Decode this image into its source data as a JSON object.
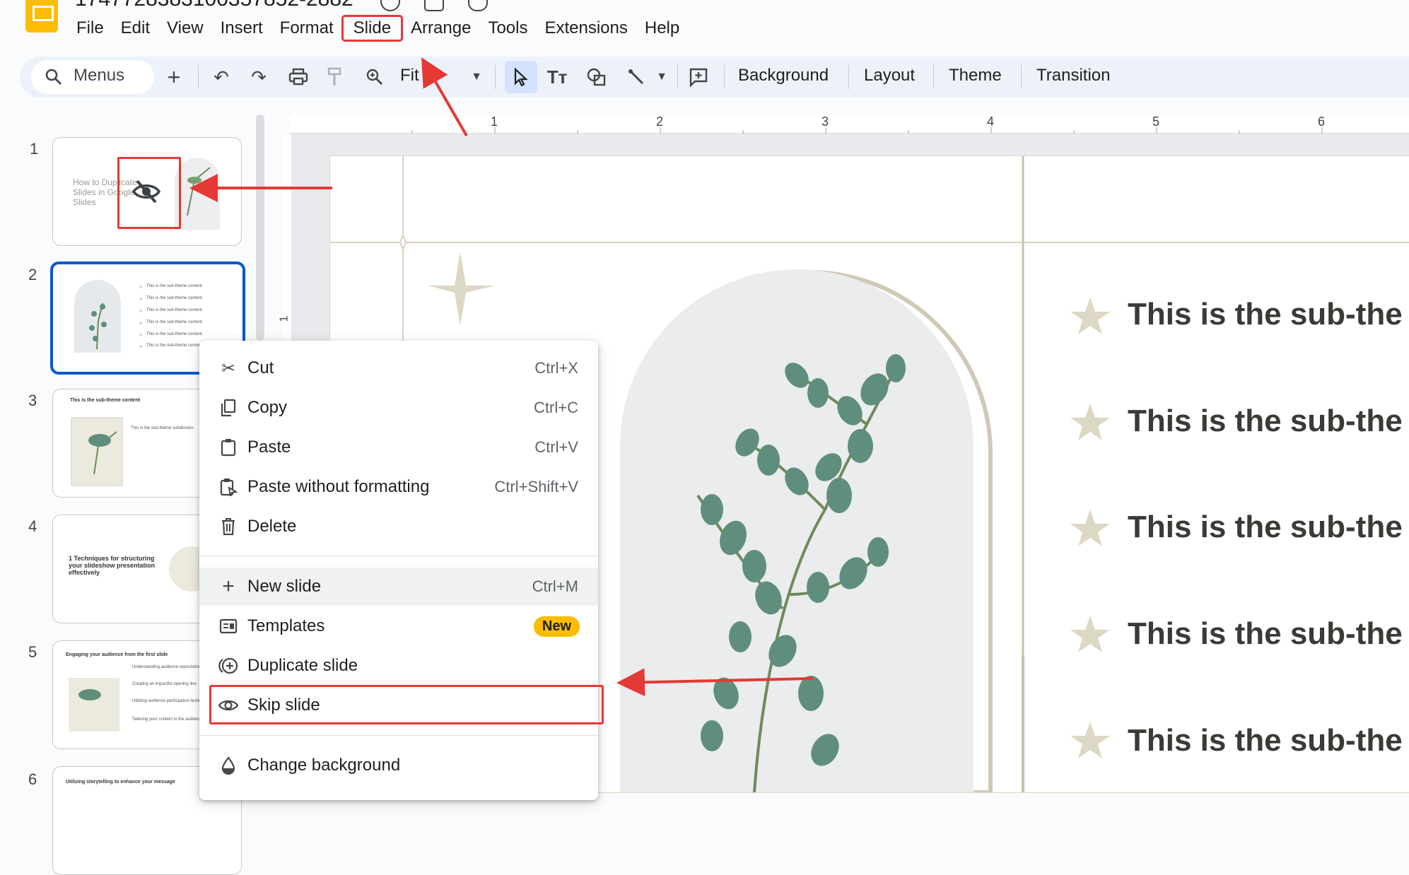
{
  "window": {
    "doc_title": "1747728383100357852-2882"
  },
  "menubar": [
    "File",
    "Edit",
    "View",
    "Insert",
    "Format",
    "Slide",
    "Arrange",
    "Tools",
    "Extensions",
    "Help"
  ],
  "toolbar": {
    "search_label": "Menus",
    "zoom_label": "Fit",
    "background_label": "Background",
    "layout_label": "Layout",
    "theme_label": "Theme",
    "transition_label": "Transition"
  },
  "ruler": {
    "marks": [
      "1",
      "2",
      "3",
      "4",
      "5",
      "6"
    ],
    "vertical_mark": "1"
  },
  "filmstrip": {
    "numbers": [
      "1",
      "2",
      "3",
      "4",
      "5",
      "6"
    ],
    "slide1_title": "How to Duplicate Slides in Google Slides",
    "slide2_item": "This is the sub-theme content.",
    "slide3_title": "This is the sub-theme content",
    "slide3_sub": "This is the sub-theme subdivision.",
    "slide4_title": "1 Techniques for structuring your slideshow presentation effectively",
    "slide5_title": "Engaging your audience from the first slide",
    "slide5_items": [
      "Understanding audience expectations",
      "Creating an impactful opening line",
      "Utilizing audience participation techniques",
      "Tailoring your content to the audience"
    ],
    "slide6_title": "Utilizing storytelling to enhance your message"
  },
  "context_menu": {
    "cut": {
      "label": "Cut",
      "shortcut": "Ctrl+X"
    },
    "copy": {
      "label": "Copy",
      "shortcut": "Ctrl+C"
    },
    "paste": {
      "label": "Paste",
      "shortcut": "Ctrl+V"
    },
    "paste_plain": {
      "label": "Paste without formatting",
      "shortcut": "Ctrl+Shift+V"
    },
    "delete": {
      "label": "Delete"
    },
    "new_slide": {
      "label": "New slide",
      "shortcut": "Ctrl+M"
    },
    "templates": {
      "label": "Templates",
      "badge": "New"
    },
    "duplicate": {
      "label": "Duplicate slide"
    },
    "skip": {
      "label": "Skip slide"
    },
    "change_bg": {
      "label": "Change background"
    }
  },
  "slide": {
    "bullets": [
      "This is the sub-the",
      "This is the sub-the",
      "This is the sub-the",
      "This is the sub-the",
      "This is the sub-the"
    ]
  },
  "colors": {
    "accent_blue": "#0b57d0",
    "annotation_red": "#e53935",
    "badge_yellow": "#fbbc04",
    "star_beige": "#ddd8c4"
  }
}
